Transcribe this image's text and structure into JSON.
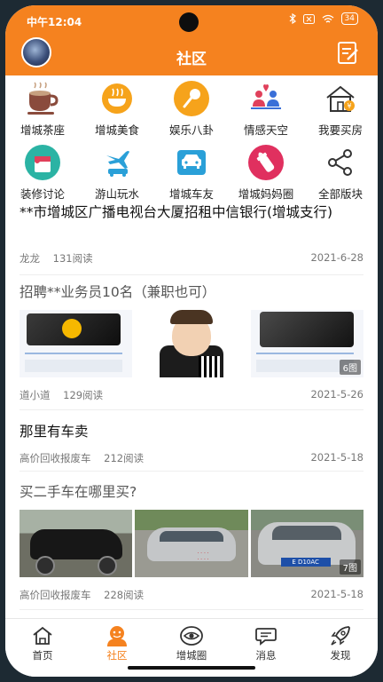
{
  "status_bar": {
    "time": "中午12:04",
    "battery": "34"
  },
  "header": {
    "title": "社区"
  },
  "categories": [
    {
      "label": "增城茶座",
      "icon": "teacup-icon"
    },
    {
      "label": "增城美食",
      "icon": "food-bowl-icon"
    },
    {
      "label": "娱乐八卦",
      "icon": "microphone-icon"
    },
    {
      "label": "情感天空",
      "icon": "people-heart-icon"
    },
    {
      "label": "我要买房",
      "icon": "house-icon"
    },
    {
      "label": "装修讨论",
      "icon": "paint-bucket-icon"
    },
    {
      "label": "游山玩水",
      "icon": "airplane-car-icon"
    },
    {
      "label": "增城车友",
      "icon": "car-icon"
    },
    {
      "label": "增城妈妈圈",
      "icon": "baby-bottle-icon"
    },
    {
      "label": "全部版块",
      "icon": "share-icon"
    }
  ],
  "posts": [
    {
      "title": "**市增城区广播电视台大厦招租中信银行(增城支行)",
      "author": "龙龙",
      "reads": "131阅读",
      "date": "2021-6-28"
    },
    {
      "title": "招聘**业务员10名（兼职也可）",
      "author": "道小道",
      "reads": "129阅读",
      "date": "2021-5-26",
      "image_count": "6图"
    },
    {
      "title": "那里有车卖",
      "author": "高价回收报废车",
      "reads": "212阅读",
      "date": "2021-5-18"
    },
    {
      "title": "买二手车在哪里买?",
      "author": "高价回收报废车",
      "reads": "228阅读",
      "date": "2021-5-18",
      "image_count": "7图",
      "plate": "E D10AC"
    }
  ],
  "tabs": [
    {
      "label": "首页",
      "icon": "home-icon"
    },
    {
      "label": "社区",
      "icon": "community-icon"
    },
    {
      "label": "增城圈",
      "icon": "eye-circle-icon"
    },
    {
      "label": "消息",
      "icon": "chat-icon"
    },
    {
      "label": "发现",
      "icon": "rocket-icon"
    }
  ],
  "colors": {
    "accent": "#f5821f",
    "text": "#222222",
    "muted": "#777777"
  }
}
